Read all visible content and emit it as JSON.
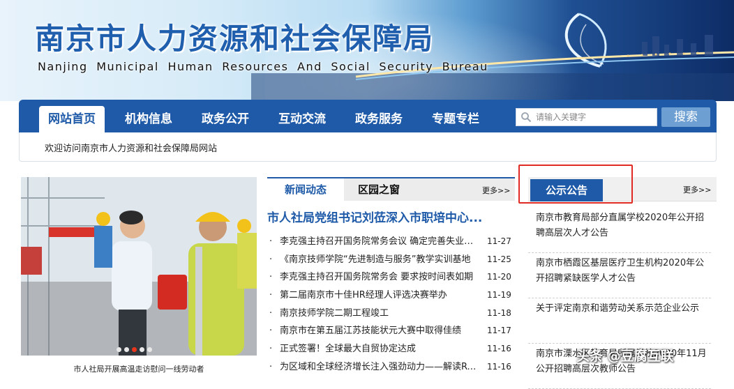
{
  "header": {
    "title": "南京市人力资源和社会保障局",
    "subtitle": "Nanjing Municipal Human Resources And Social Security Bureau"
  },
  "nav": {
    "items": [
      {
        "label": "网站首页",
        "active": true
      },
      {
        "label": "机构信息",
        "active": false
      },
      {
        "label": "政务公开",
        "active": false
      },
      {
        "label": "互动交流",
        "active": false
      },
      {
        "label": "政务服务",
        "active": false
      },
      {
        "label": "专题专栏",
        "active": false
      }
    ],
    "search": {
      "placeholder": "请输入关键字",
      "button_label": "搜索",
      "icon": "search-icon"
    }
  },
  "welcome": {
    "text": "欢迎访问南京市人力资源和社会保障局网站"
  },
  "photo": {
    "caption": "市人社局开展高温走访慰问一线劳动者",
    "slide_count": 5,
    "active_slide": 3
  },
  "news": {
    "tabs": [
      "新闻动态",
      "区园之窗"
    ],
    "active_tab": 0,
    "more_label": "更多>>",
    "headline": "市人社局党组书记刘莅深入市职培中心...",
    "bullet": "·",
    "items": [
      {
        "title": "李克强主持召开国务院常务会议 确定完善失业保险",
        "date": "11-27"
      },
      {
        "title": "《南京技师学院“先进制造与服务”教学实训基地",
        "date": "11-25"
      },
      {
        "title": "李克强主持召开国务院常务会 要求按时间表如期",
        "date": "11-20"
      },
      {
        "title": "第二届南京市十佳HR经理人评选决赛举办",
        "date": "11-19"
      },
      {
        "title": "南京技师学院二期工程竣工",
        "date": "11-18"
      },
      {
        "title": "南京市在第五届江苏技能状元大赛中取得佳绩",
        "date": "11-17"
      },
      {
        "title": "正式签署！全球最大自贸协定达成",
        "date": "11-16"
      },
      {
        "title": "为区域和全球经济增长注入强劲动力——解读RCEP",
        "date": "11-16"
      }
    ]
  },
  "notice": {
    "tab": "公示公告",
    "more_label": "更多>>",
    "items": [
      {
        "title": "南京市教育局部分直属学校2020年公开招聘高层次人才公告"
      },
      {
        "title": "南京市栖霞区基层医疗卫生机构2020年公开招聘紧缺医学人才公告"
      },
      {
        "title": "关于评定南京和谐劳动关系示范企业公示"
      },
      {
        "title": "南京市溧水区教育局所属学校2020年11月公开招聘高层次教师公告"
      }
    ]
  },
  "watermark": {
    "text": "头条 @豆腐互联"
  },
  "colors": {
    "brand_blue": "#1e5aa8",
    "highlight_red": "#e02a24",
    "slide_dot_active": "#e8351b"
  }
}
